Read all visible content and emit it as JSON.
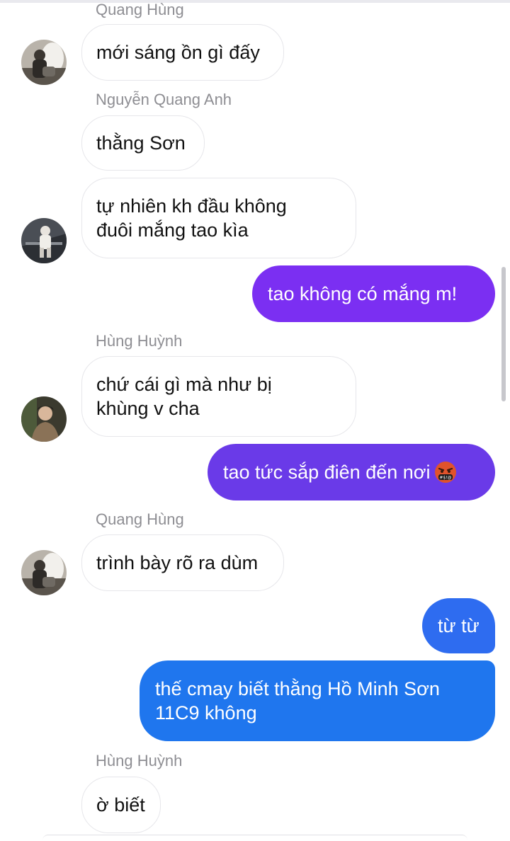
{
  "chat": {
    "messages": [
      {
        "sender": "Quang Hùng",
        "lines": [
          "mới sáng ồn gì đấy"
        ],
        "direction": "incoming"
      },
      {
        "sender": "Nguyễn Quang Anh",
        "lines": [
          "thằng Sơn"
        ],
        "direction": "incoming"
      },
      {
        "sender": "",
        "lines": [
          "tự nhiên kh đầu không",
          "đuôi mắng tao kìa"
        ],
        "direction": "incoming"
      },
      {
        "sender": "",
        "lines": [
          "tao không có mắng m!"
        ],
        "direction": "outgoing"
      },
      {
        "sender": "Hùng Huỳnh",
        "lines": [
          "chứ cái gì mà như bị",
          "khùng v cha"
        ],
        "direction": "incoming"
      },
      {
        "sender": "",
        "lines": [
          "tao tức sắp điên đến nơi"
        ],
        "emoji": "cursing-face-emoji",
        "direction": "outgoing"
      },
      {
        "sender": "Quang Hùng",
        "lines": [
          "trình bày rõ ra dùm"
        ],
        "direction": "incoming"
      },
      {
        "sender": "",
        "lines": [
          "từ từ"
        ],
        "direction": "outgoing"
      },
      {
        "sender": "",
        "lines": [
          "thế cmay biết thằng Hồ Minh Sơn",
          "11C9 không"
        ],
        "direction": "outgoing"
      },
      {
        "sender": "Hùng Huỳnh",
        "lines": [
          "ờ biết"
        ],
        "direction": "incoming"
      }
    ]
  },
  "colors": {
    "outgoing_gradient": [
      "#7b2ff2",
      "#6a3ae8",
      "#4a56e6",
      "#2e6cf0",
      "#1f76ee"
    ],
    "incoming_bubble": "#ffffff",
    "sender_text": "#8e8e93"
  }
}
